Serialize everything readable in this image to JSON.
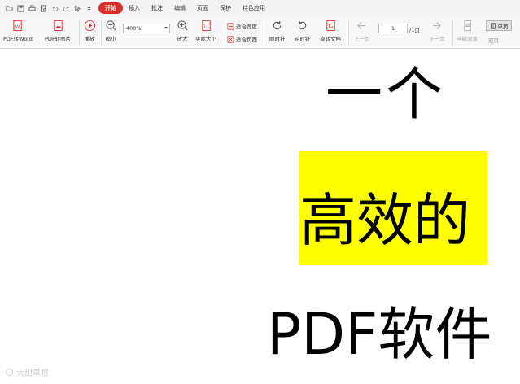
{
  "menubar": {
    "tabs": [
      {
        "label": "开始",
        "active": true
      },
      {
        "label": "插入",
        "active": false
      },
      {
        "label": "批注",
        "active": false
      },
      {
        "label": "编辑",
        "active": false
      },
      {
        "label": "页面",
        "active": false
      },
      {
        "label": "保护",
        "active": false
      },
      {
        "label": "特色应用",
        "active": false
      }
    ]
  },
  "ribbon": {
    "pdf_to_word": "PDF转Word",
    "pdf_to_image": "PDF转图片",
    "play": "播放",
    "zoom_out": "缩小",
    "zoom_value": "400%",
    "zoom_in": "放大",
    "actual_size": "实际大小",
    "fit_width": "适合宽度",
    "fit_page": "适合页面",
    "rotate_cw": "顺时针",
    "rotate_ccw": "逆时针",
    "rotate_doc": "旋转文档",
    "prev_page": "上一页",
    "page_current": "1",
    "page_total": "/1页",
    "next_page": "下一页",
    "continuous": "连续阅读",
    "single_page": "单页",
    "view": "双页"
  },
  "document": {
    "line1": "一个",
    "line2": "高效的",
    "line3": "PDF软件"
  },
  "watermark": "大甜草根",
  "colors": {
    "active_tab": "#d9302c",
    "highlight": "#ffff00"
  }
}
